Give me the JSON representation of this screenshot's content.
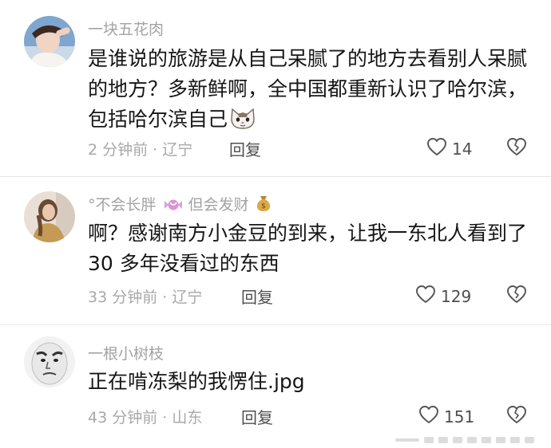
{
  "comments": [
    {
      "username": "一块五花肉",
      "content": "是谁说的旅游是从自己呆腻了的地方去看别人呆腻的地方？多新鲜啊，全中国都重新认识了哈尔滨，包括哈尔滨自己",
      "emoji": "cat-face-emoji",
      "time": "2 分钟前 · 辽宁",
      "reply_label": "回复",
      "likes": "14"
    },
    {
      "username": "°不会长胖",
      "username_middle": "但会发财",
      "username_emojis": [
        "candy-emoji",
        "money-bag-emoji"
      ],
      "content": "啊？感谢南方小金豆的到来，让我一东北人看到了 30 多年没看过的东西",
      "time": "33 分钟前 · 辽宁",
      "reply_label": "回复",
      "likes": "129"
    },
    {
      "username": "一根小树枝",
      "content": "正在啃冻梨的我愣住.jpg",
      "time": "43 分钟前 · 山东",
      "reply_label": "回复",
      "likes": "151"
    }
  ],
  "icons": {
    "like": "heart-outline-icon",
    "dislike": "broken-heart-outline-icon"
  },
  "colors": {
    "text": "#161616",
    "secondary": "#a3a3a3",
    "divider": "#e6e6e6"
  }
}
